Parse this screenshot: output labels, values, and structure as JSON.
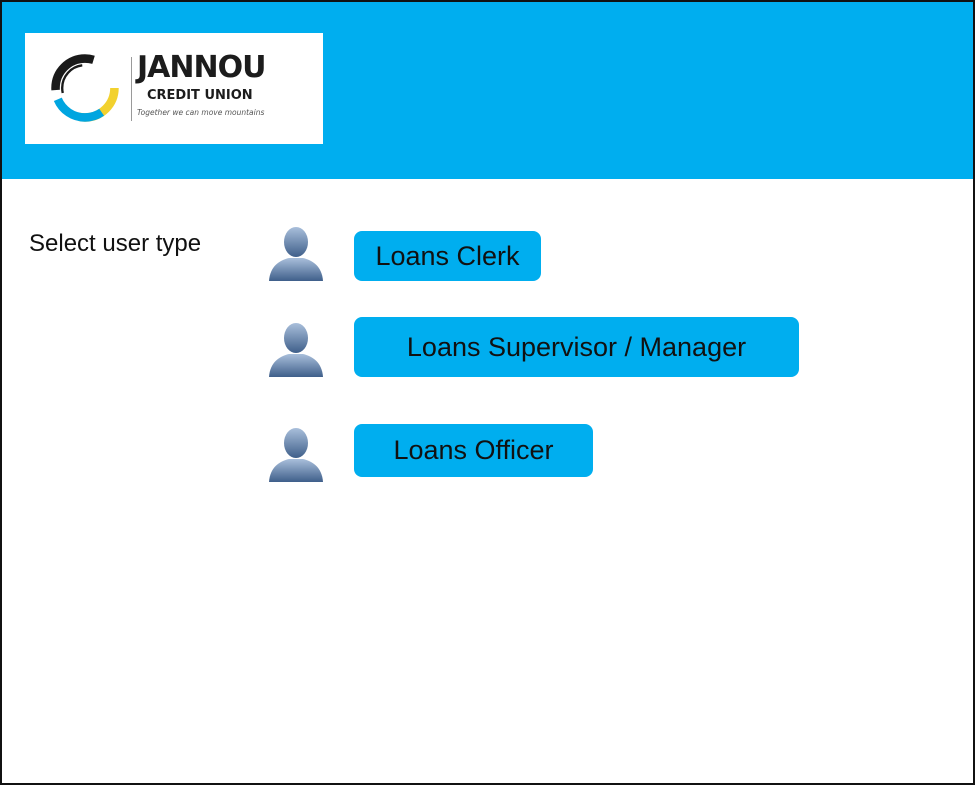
{
  "colors": {
    "brand": "#00aeef",
    "icon_top": "#9fb6d3",
    "icon_bottom": "#3f5f8a"
  },
  "header": {
    "logo": {
      "name": "JANNOU",
      "subtitle": "CREDIT UNION",
      "tagline": "Together we can move mountains"
    }
  },
  "main": {
    "prompt": "Select user type",
    "user_types": [
      {
        "label": "Loans Clerk",
        "icon": "user-icon"
      },
      {
        "label": "Loans Supervisor / Manager",
        "icon": "user-icon"
      },
      {
        "label": "Loans Officer",
        "icon": "user-icon"
      }
    ]
  }
}
